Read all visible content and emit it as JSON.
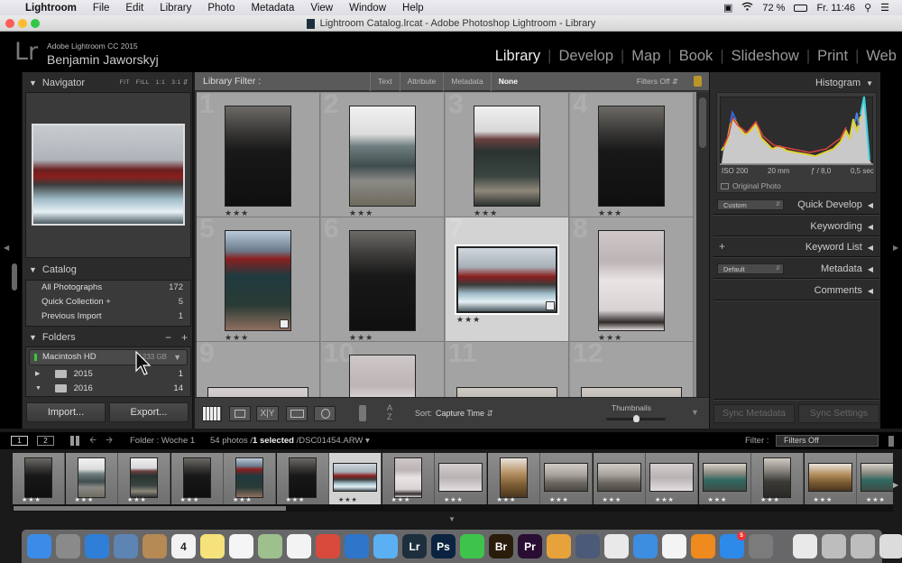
{
  "menubar": {
    "apple": "",
    "app": "Lightroom",
    "items": [
      "File",
      "Edit",
      "Library",
      "Photo",
      "Metadata",
      "View",
      "Window",
      "Help"
    ],
    "battery": "72 %",
    "clock": "Fr. 11:46",
    "status_icons": [
      "camera-icon",
      "wifi-icon",
      "battery-icon",
      "search-icon",
      "list-icon"
    ]
  },
  "window": {
    "title": "Lightroom Catalog.lrcat - Adobe Photoshop Lightroom - Library"
  },
  "header": {
    "logo": "Lr",
    "product": "Adobe Lightroom CC 2015",
    "user": "Benjamin Jaworskyj",
    "modules": [
      {
        "label": "Library",
        "active": true
      },
      {
        "label": "Develop"
      },
      {
        "label": "Map"
      },
      {
        "label": "Book"
      },
      {
        "label": "Slideshow"
      },
      {
        "label": "Print"
      },
      {
        "label": "Web"
      }
    ]
  },
  "left_panel": {
    "navigator": {
      "title": "Navigator",
      "zoom_options": [
        "FIT",
        "FILL",
        "1:1",
        "3:1"
      ]
    },
    "catalog": {
      "title": "Catalog",
      "items": [
        {
          "label": "All Photographs",
          "count": "172"
        },
        {
          "label": "Quick Collection +",
          "count": "5"
        },
        {
          "label": "Previous Import",
          "count": "1"
        }
      ]
    },
    "folders": {
      "title": "Folders",
      "minus": "−",
      "plus": "+",
      "volume": {
        "name": "Macintosh HD",
        "space": "/ 233 GB"
      },
      "items": [
        {
          "arrow": "▶",
          "label": "2015",
          "count": "1"
        },
        {
          "arrow": "▼",
          "label": "2016",
          "count": "14"
        }
      ]
    },
    "import_label": "Import...",
    "export_label": "Export..."
  },
  "filter_bar": {
    "title": "Library Filter :",
    "options": [
      "Text",
      "Attribute",
      "Metadata",
      "None"
    ],
    "active": "None",
    "filters_off": "Filters Off"
  },
  "grid": {
    "cells": [
      {
        "num": "1",
        "rating": "★★★",
        "orient": "portrait",
        "tone": "dark"
      },
      {
        "num": "2",
        "rating": "★★★",
        "orient": "portrait",
        "tone": "sea"
      },
      {
        "num": "3",
        "rating": "★★★",
        "orient": "portrait",
        "tone": "harbor"
      },
      {
        "num": "4",
        "rating": "★★★",
        "orient": "portrait",
        "tone": "dark"
      },
      {
        "num": "5",
        "rating": "★★★",
        "orient": "portrait",
        "tone": "lake"
      },
      {
        "num": "6",
        "rating": "★★★",
        "orient": "portrait",
        "tone": "dark"
      },
      {
        "num": "7",
        "rating": "★★★",
        "orient": "landscape",
        "tone": "red",
        "selected": true
      },
      {
        "num": "8",
        "rating": "★★★",
        "orient": "portrait",
        "tone": "snow"
      },
      {
        "num": "9",
        "rating": "",
        "orient": "landscape",
        "tone": "fog"
      },
      {
        "num": "10",
        "rating": "",
        "orient": "portrait",
        "tone": "snow"
      },
      {
        "num": "11",
        "rating": "",
        "orient": "landscape",
        "tone": "grey"
      },
      {
        "num": "12",
        "rating": "",
        "orient": "landscape",
        "tone": "grey"
      }
    ]
  },
  "toolbar": {
    "sort_label": "Sort:",
    "sort_value": "Capture Time",
    "thumbnails_label": "Thumbnails",
    "thumbnail_size": 0.5
  },
  "right_panel": {
    "histogram": {
      "title": "Histogram",
      "iso": "ISO 200",
      "focal": "20 mm",
      "aperture": "ƒ / 8,0",
      "shutter": "0,5 sec",
      "original_photo": "Original Photo"
    },
    "quick_develop": {
      "title": "Quick Develop",
      "preset": "Custom"
    },
    "keywording": {
      "title": "Keywording"
    },
    "keyword_list": {
      "title": "Keyword List",
      "plus": "+"
    },
    "metadata": {
      "title": "Metadata",
      "preset": "Default"
    },
    "comments": {
      "title": "Comments"
    },
    "sync_metadata": "Sync Metadata",
    "sync_settings": "Sync Settings"
  },
  "filmstrip_bar": {
    "screen1": "1",
    "screen2": "2",
    "source": "Folder : Woche 1",
    "count_prefix": "54 photos /",
    "selected": "1 selected",
    "file": "/DSC01454.ARW",
    "filter_label": "Filter :",
    "filter_value": "Filters Off"
  },
  "filmstrip": {
    "items": [
      {
        "tone": "dark",
        "orient": "portrait"
      },
      {
        "tone": "sea",
        "orient": "portrait"
      },
      {
        "tone": "harbor",
        "orient": "portrait"
      },
      {
        "tone": "dark",
        "orient": "portrait"
      },
      {
        "tone": "lake",
        "orient": "portrait"
      },
      {
        "tone": "dark",
        "orient": "portrait"
      },
      {
        "tone": "red",
        "orient": "landscape",
        "selected": true
      },
      {
        "tone": "snow",
        "orient": "portrait"
      },
      {
        "tone": "fog",
        "orient": "landscape"
      },
      {
        "tone": "brown",
        "orient": "portrait"
      },
      {
        "tone": "grey",
        "orient": "landscape"
      },
      {
        "tone": "grey",
        "orient": "landscape"
      },
      {
        "tone": "fog",
        "orient": "landscape"
      },
      {
        "tone": "teal",
        "orient": "landscape"
      },
      {
        "tone": "rock",
        "orient": "portrait"
      },
      {
        "tone": "brown",
        "orient": "landscape"
      },
      {
        "tone": "teal",
        "orient": "landscape"
      }
    ],
    "rating": "★★★"
  },
  "dock": {
    "apps": [
      {
        "name": "finder",
        "label": "",
        "color": "#3b8ce8"
      },
      {
        "name": "launchpad",
        "label": "",
        "color": "#8a8a8a"
      },
      {
        "name": "safari",
        "label": "",
        "color": "#2f7fd8"
      },
      {
        "name": "preview",
        "label": "",
        "color": "#5d84b3"
      },
      {
        "name": "contacts",
        "label": "",
        "color": "#b58a55"
      },
      {
        "name": "calendar",
        "label": "4",
        "color": "#f2f2f2"
      },
      {
        "name": "notes",
        "label": "",
        "color": "#f6e27a"
      },
      {
        "name": "reminders",
        "label": "",
        "color": "#f5f5f5"
      },
      {
        "name": "maps",
        "label": "",
        "color": "#9ec08d"
      },
      {
        "name": "photos",
        "label": "",
        "color": "#f3f3f3"
      },
      {
        "name": "chrome",
        "label": "",
        "color": "#d84a3b"
      },
      {
        "name": "openoffice",
        "label": "",
        "color": "#2e76c9"
      },
      {
        "name": "messages",
        "label": "",
        "color": "#5ab0f2"
      },
      {
        "name": "lightroom",
        "label": "Lr",
        "color": "#1d2f3c"
      },
      {
        "name": "photoshop",
        "label": "Ps",
        "color": "#0b2340"
      },
      {
        "name": "facetime",
        "label": "",
        "color": "#3fc44b"
      },
      {
        "name": "bridge",
        "label": "Br",
        "color": "#2a1c0a"
      },
      {
        "name": "premiere",
        "label": "Pr",
        "color": "#2a0d33"
      },
      {
        "name": "pages",
        "label": "",
        "color": "#e8a23b"
      },
      {
        "name": "imovie",
        "label": "",
        "color": "#4b5a78"
      },
      {
        "name": "numbers",
        "label": "",
        "color": "#e9e9e9"
      },
      {
        "name": "keynote",
        "label": "",
        "color": "#3d8de0"
      },
      {
        "name": "itunes",
        "label": "",
        "color": "#f4f4f4"
      },
      {
        "name": "ibooks",
        "label": "",
        "color": "#ef8a1f"
      },
      {
        "name": "appstore",
        "label": "",
        "color": "#2d8ae8",
        "badge": "5"
      },
      {
        "name": "system-preferences",
        "label": "",
        "color": "#7b7b7b"
      }
    ],
    "others": [
      {
        "name": "downloads",
        "color": "#e9e9e9"
      },
      {
        "name": "screenshot-1",
        "color": "#bdbdbd"
      },
      {
        "name": "screenshot-2",
        "color": "#bdbdbd"
      },
      {
        "name": "trash",
        "color": "#dcdcdc"
      }
    ]
  }
}
